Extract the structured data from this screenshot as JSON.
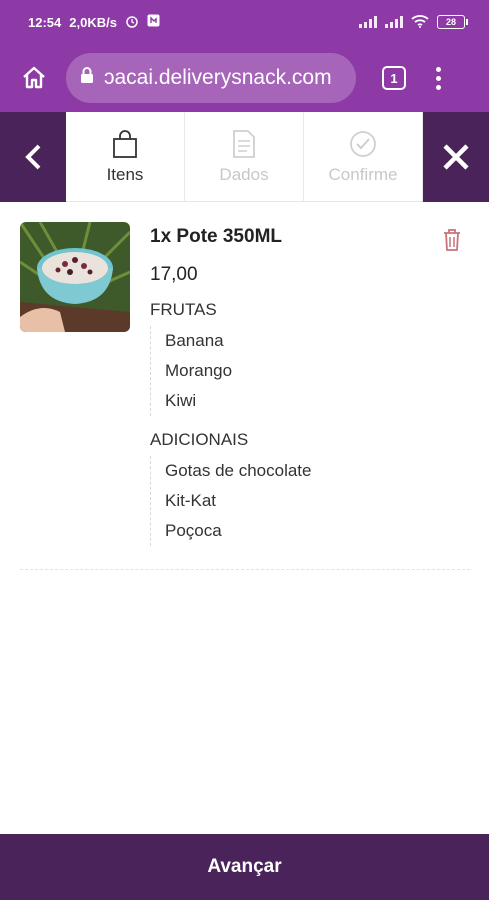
{
  "status_bar": {
    "time": "12:54",
    "speed": "2,0KB/s",
    "battery": "28"
  },
  "browser": {
    "url": "ɔacai.deliverysnack.com",
    "tab_count": "1"
  },
  "steps": [
    {
      "label": "Itens",
      "state": "active"
    },
    {
      "label": "Dados",
      "state": "inactive"
    },
    {
      "label": "Confirme",
      "state": "inactive"
    }
  ],
  "item": {
    "title": "1x Pote 350ML",
    "price": "17,00",
    "groups": [
      {
        "name": "FRUTAS",
        "options": [
          "Banana",
          "Morango",
          "Kiwi"
        ]
      },
      {
        "name": "ADICIONAIS",
        "options": [
          "Gotas de chocolate",
          "Kit-Kat",
          "Poçoca"
        ]
      }
    ]
  },
  "footer": {
    "advance_label": "Avançar"
  },
  "colors": {
    "status_purple": "#8e3aa6",
    "dark_purple": "#4a235a",
    "trash_red": "#c0392b"
  }
}
